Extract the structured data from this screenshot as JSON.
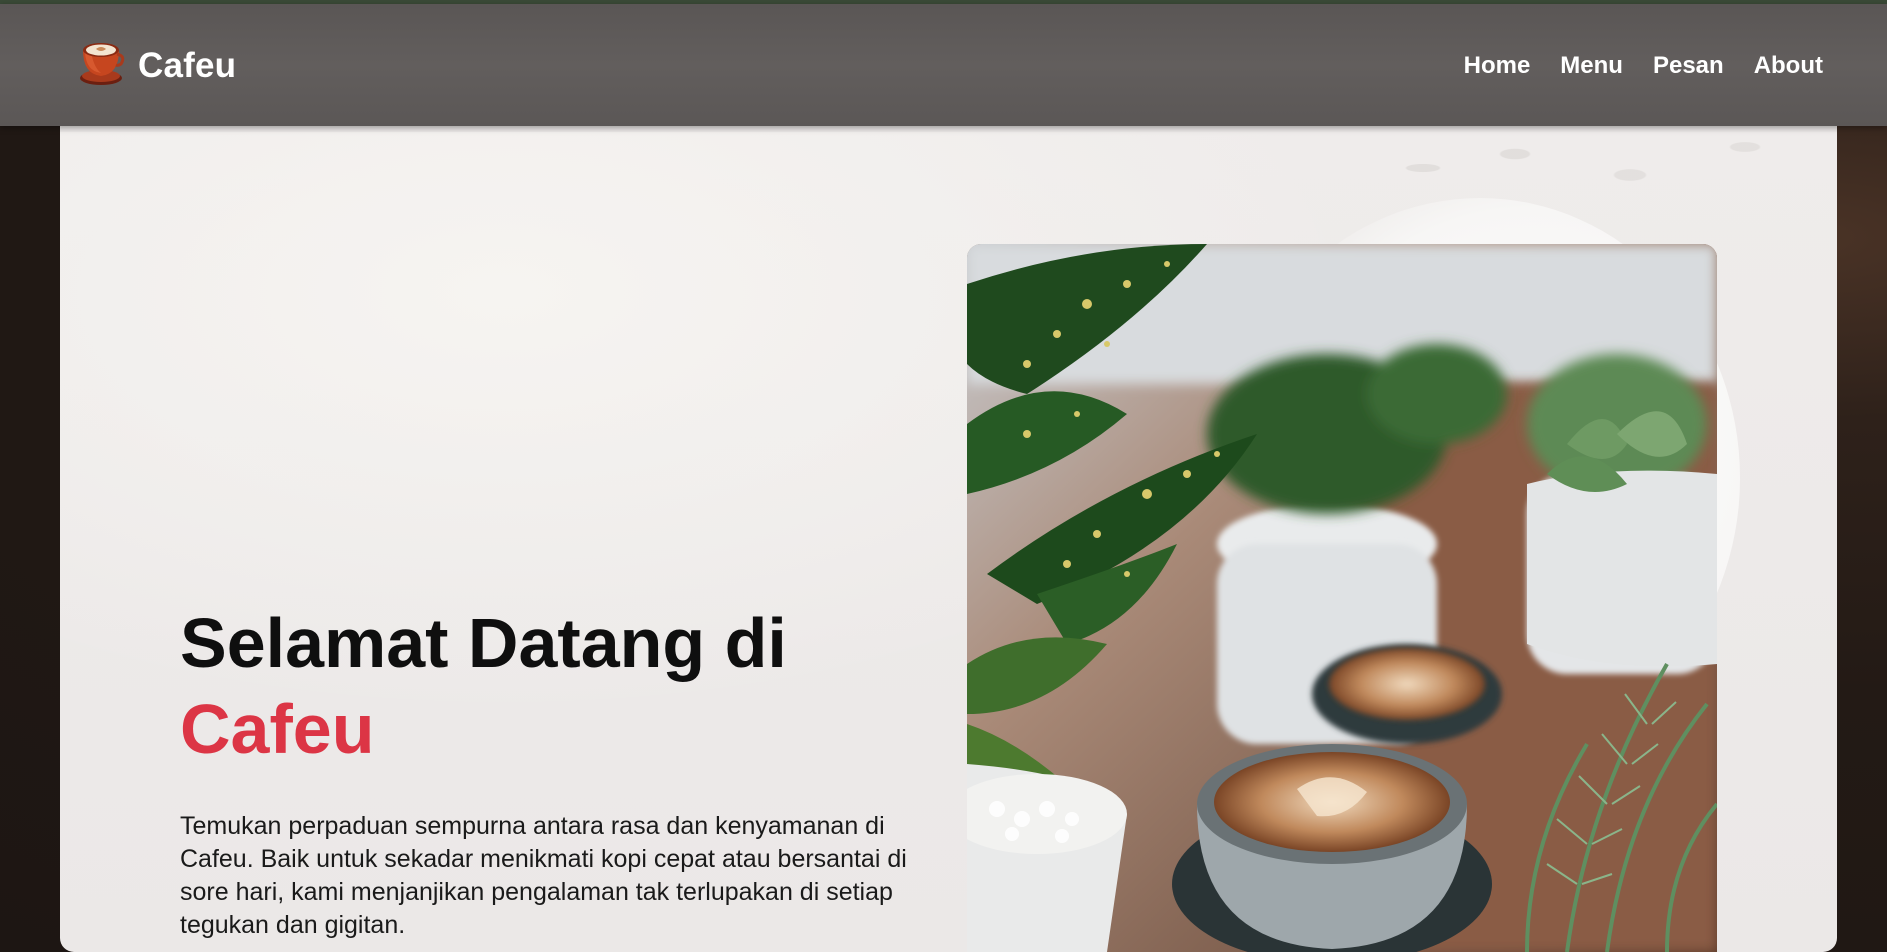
{
  "brand": {
    "name": "Cafeu",
    "logo_icon": "coffee-cup-icon"
  },
  "nav": {
    "items": [
      {
        "label": "Home"
      },
      {
        "label": "Menu"
      },
      {
        "label": "Pesan"
      },
      {
        "label": "About"
      }
    ]
  },
  "hero": {
    "title_line1": "Selamat Datang di",
    "title_accent": "Cafeu",
    "description": "Temukan perpaduan sempurna antara rasa dan kenyamanan di Cafeu. Baik untuk sekadar menikmati kopi cepat atau bersantai di sore hari, kami menjanjikan pengalaman tak terlupakan di setiap tegukan dan gigitan."
  },
  "colors": {
    "accent": "#dc3545",
    "navbar": "#5f5b5a",
    "text": "#0f0f0f"
  }
}
